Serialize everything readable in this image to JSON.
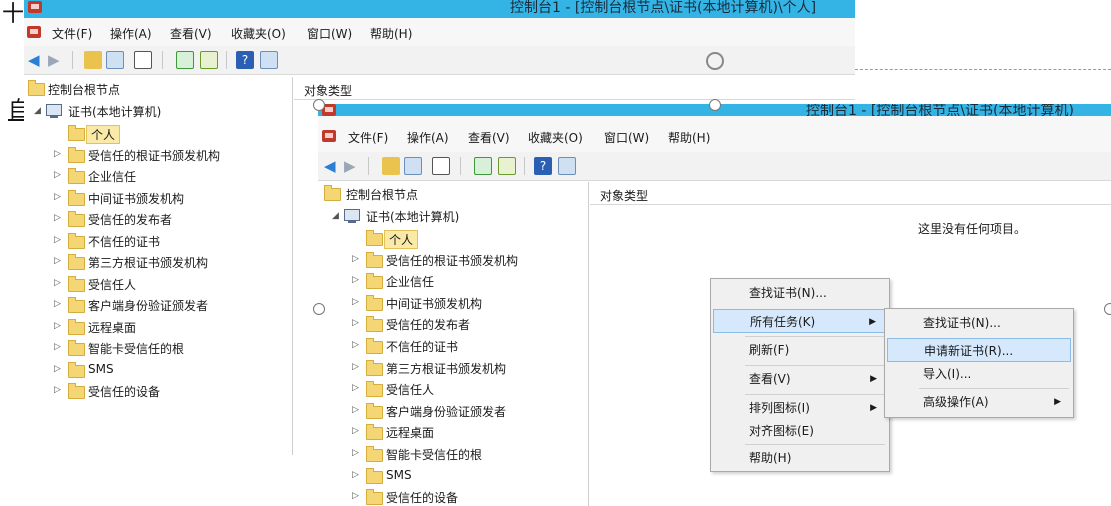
{
  "doc": {
    "char_top": "十",
    "char_mid": "自"
  },
  "window_back": {
    "title": "控制台1 - [控制台根节点\\证书(本地计算机)\\个人]",
    "menu": [
      "文件(F)",
      "操作(A)",
      "查看(V)",
      "收藏夹(O)",
      "窗口(W)",
      "帮助(H)"
    ],
    "tree_root": "控制台根节点",
    "tree_cert": "证书(本地计算机)",
    "tree_items": [
      "个人",
      "受信任的根证书颁发机构",
      "企业信任",
      "中间证书颁发机构",
      "受信任的发布者",
      "不信任的证书",
      "第三方根证书颁发机构",
      "受信任人",
      "客户端身份验证颁发者",
      "远程桌面",
      "智能卡受信任的根",
      "SMS",
      "受信任的设备"
    ],
    "pane_header": "对象类型"
  },
  "window_front": {
    "title": "控制台1 - [控制台根节点\\证书(本地计算机)",
    "menu": [
      "文件(F)",
      "操作(A)",
      "查看(V)",
      "收藏夹(O)",
      "窗口(W)",
      "帮助(H)"
    ],
    "tree_root": "控制台根节点",
    "tree_cert": "证书(本地计算机)",
    "tree_items": [
      "个人",
      "受信任的根证书颁发机构",
      "企业信任",
      "中间证书颁发机构",
      "受信任的发布者",
      "不信任的证书",
      "第三方根证书颁发机构",
      "受信任人",
      "客户端身份验证颁发者",
      "远程桌面",
      "智能卡受信任的根",
      "SMS",
      "受信任的设备"
    ],
    "pane_header": "对象类型",
    "empty_message": "这里没有任何项目。"
  },
  "context_menu": {
    "items": [
      "查找证书(N)...",
      "所有任务(K)",
      "刷新(F)",
      "查看(V)",
      "排列图标(I)",
      "对齐图标(E)",
      "帮助(H)"
    ]
  },
  "submenu": {
    "items": [
      "查找证书(N)...",
      "申请新证书(R)...",
      "导入(I)...",
      "高级操作(A)"
    ]
  }
}
